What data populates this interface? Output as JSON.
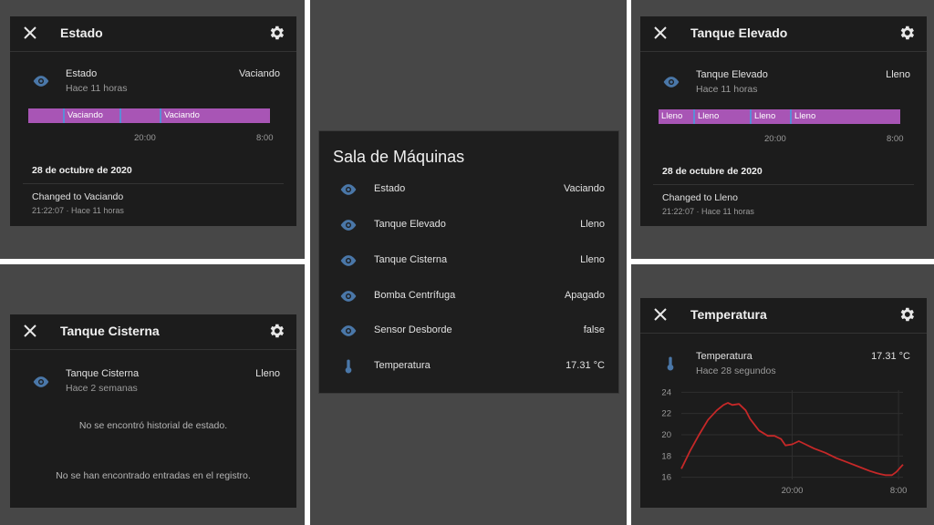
{
  "card": {
    "title": "Sala de Máquinas",
    "rows": [
      {
        "name": "Estado",
        "state": "Vaciando",
        "icon": "eye-icon"
      },
      {
        "name": "Tanque Elevado",
        "state": "Lleno",
        "icon": "eye-icon"
      },
      {
        "name": "Tanque Cisterna",
        "state": "Lleno",
        "icon": "eye-icon"
      },
      {
        "name": "Bomba Centrífuga",
        "state": "Apagado",
        "icon": "eye-icon"
      },
      {
        "name": "Sensor Desborde",
        "state": "false",
        "icon": "eye-icon"
      },
      {
        "name": "Temperatura",
        "state": "17.31 °C",
        "icon": "thermometer-icon"
      }
    ]
  },
  "estado_dialog": {
    "title": "Estado",
    "entity": {
      "name": "Estado",
      "state": "Vaciando",
      "updated": "Hace 11 horas"
    },
    "timeline": {
      "segments": [
        "Vaciando",
        "Vaciando"
      ],
      "axis": [
        "20:00",
        "8:00"
      ]
    },
    "date_header": "28 de octubre de 2020",
    "log": {
      "message": "Changed to Vaciando",
      "time": "21:22:07 · Hace 11 horas"
    }
  },
  "elevado_dialog": {
    "title": "Tanque Elevado",
    "entity": {
      "name": "Tanque Elevado",
      "state": "Lleno",
      "updated": "Hace 11 horas"
    },
    "timeline": {
      "segments": [
        "Lleno",
        "Lleno",
        "Lleno",
        "Lleno"
      ],
      "axis": [
        "20:00",
        "8:00"
      ]
    },
    "date_header": "28 de octubre de 2020",
    "log": {
      "message": "Changed to Lleno",
      "time": "21:22:07 · Hace 11 horas"
    }
  },
  "cisterna_dialog": {
    "title": "Tanque Cisterna",
    "entity": {
      "name": "Tanque Cisterna",
      "state": "Lleno",
      "updated": "Hace 2 semanas"
    },
    "no_history": "No se encontró historial de estado.",
    "no_log": "No se han encontrado entradas en el registro."
  },
  "temp_dialog": {
    "title": "Temperatura",
    "entity": {
      "name": "Temperatura",
      "state": "17.31 °C",
      "updated": "Hace 28 segundos"
    }
  },
  "chart_data": {
    "type": "line",
    "x_ticks": [
      "20:00",
      "8:00"
    ],
    "y_ticks": [
      24,
      22,
      20,
      18,
      16
    ],
    "ylim": [
      15.8,
      24.2
    ],
    "line_color": "#c62828",
    "x": [
      0.0,
      0.04,
      0.08,
      0.12,
      0.16,
      0.19,
      0.21,
      0.23,
      0.26,
      0.29,
      0.31,
      0.35,
      0.39,
      0.42,
      0.45,
      0.47,
      0.5,
      0.53,
      0.56,
      0.6,
      0.65,
      0.7,
      0.75,
      0.8,
      0.85,
      0.88,
      0.9,
      0.92,
      0.95,
      0.97,
      1.0
    ],
    "y": [
      16.8,
      18.5,
      20.0,
      21.4,
      22.3,
      22.8,
      23.0,
      22.8,
      22.9,
      22.3,
      21.5,
      20.4,
      19.9,
      19.9,
      19.6,
      19.0,
      19.1,
      19.4,
      19.1,
      18.7,
      18.3,
      17.8,
      17.4,
      17.0,
      16.6,
      16.4,
      16.3,
      16.2,
      16.2,
      16.5,
      17.2
    ]
  },
  "colors": {
    "background": "#474747",
    "dialog": "#1c1c1c",
    "timeline": "#a855b5",
    "icon": "#4a77a8"
  }
}
